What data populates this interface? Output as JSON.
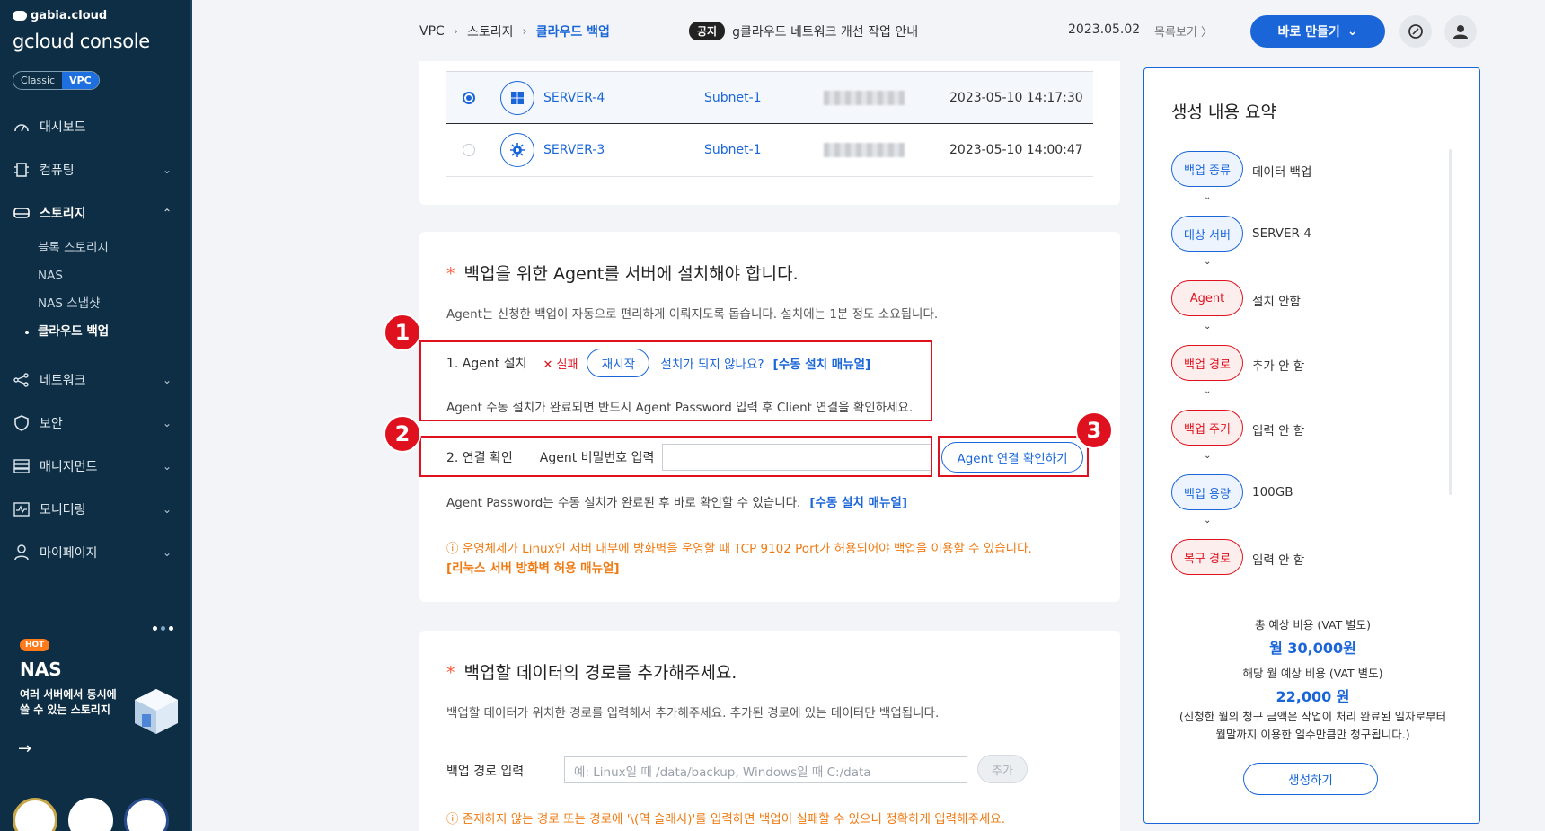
{
  "sidebar": {
    "brand_top": "gabia.cloud",
    "brand_main": "gcloud console",
    "mode_classic": "Classic",
    "mode_vpc": "VPC",
    "items": [
      {
        "label": "대시보드"
      },
      {
        "label": "컴퓨팅"
      },
      {
        "label": "스토리지"
      },
      {
        "label": "네트워크"
      },
      {
        "label": "보안"
      },
      {
        "label": "매니지먼트"
      },
      {
        "label": "모니터링"
      },
      {
        "label": "마이페이지"
      }
    ],
    "storage_sub": [
      {
        "label": "블록 스토리지"
      },
      {
        "label": "NAS"
      },
      {
        "label": "NAS 스냅샷"
      },
      {
        "label": "클라우드 백업"
      }
    ],
    "promo": {
      "badge": "HOT",
      "title": "NAS",
      "desc": "여러 서버에서 동시에 쓸 수 있는 스토리지",
      "arrow": "→"
    }
  },
  "topbar": {
    "crumbs": [
      "VPC",
      "스토리지",
      "클라우드 백업"
    ],
    "crumb_sep": "›",
    "notice_badge": "공지",
    "notice_text": "g클라우드 네트워크 개선 작업 안내",
    "notice_date": "2023.05.02",
    "notice_more": "목록보기 〉",
    "create_label": "바로 만들기"
  },
  "servers": [
    {
      "name": "SERVER-4",
      "subnet": "Subnet-1",
      "created": "2023-05-10 14:17:30",
      "selected": true,
      "os": "windows"
    },
    {
      "name": "SERVER-3",
      "subnet": "Subnet-1",
      "created": "2023-05-10 14:00:47",
      "selected": false,
      "os": "linux"
    }
  ],
  "agent_section": {
    "required_mark": "*",
    "title": "백업을 위한 Agent를 서버에 설치해야 합니다.",
    "desc": "Agent는 신청한 백업이 자동으로 편리하게 이뤄지도록 돕습니다. 설치에는 1분 정도 소요됩니다.",
    "step1_label": "1. Agent 설치",
    "fail_label": "✕ 실패",
    "retry_label": "재시작",
    "help_q": "설치가 되지 않나요?",
    "manual_link": "[수동 설치 매뉴얼]",
    "step1_note": "Agent 수동 설치가 완료되면 반드시 Agent Password 입력 후 Client 연결을 확인하세요.",
    "step2_label": "2. 연결 확인",
    "pw_label": "Agent 비밀번호 입력",
    "pw_value": "",
    "confirm_label": "Agent 연결 확인하기",
    "pw_note": "Agent Password는 수동 설치가 완료된 후 바로 확인할 수 있습니다.",
    "warning": "ⓘ 운영체제가 Linux인 서버 내부에 방화벽을 운영할 때 TCP 9102 Port가 허용되어야 백업을 이용할 수 있습니다.",
    "warning_link": "[리눅스 서버 방화벽 허용 매뉴얼]",
    "annotations": [
      "1",
      "2",
      "3"
    ]
  },
  "path_section": {
    "required_mark": "*",
    "title": "백업할 데이터의 경로를 추가해주세요.",
    "desc": "백업할 데이터가 위치한 경로를 입력해서 추가해주세요. 추가된 경로에 있는 데이터만 백업됩니다.",
    "input_label": "백업 경로 입력",
    "placeholder": "예: Linux일 때 /data/backup, Windows일 때 C:/data",
    "add_label": "추가",
    "warning": "ⓘ 존재하지 않는 경로 또는 경로에 '\\(역 슬래시)'를 입력하면 백업이 실패할 수 있으니 정확하게 입력해주세요."
  },
  "summary": {
    "title": "생성 내용 요약",
    "items": [
      {
        "label": "백업 종류",
        "value": "데이터 백업",
        "status": "ok"
      },
      {
        "label": "대상 서버",
        "value": "SERVER-4",
        "status": "ok"
      },
      {
        "label": "Agent",
        "value": "설치 안함",
        "status": "warn"
      },
      {
        "label": "백업 경로",
        "value": "추가 안 함",
        "status": "warn"
      },
      {
        "label": "백업 주기",
        "value": "입력 안 함",
        "status": "warn"
      },
      {
        "label": "백업 용량",
        "value": "100GB",
        "status": "ok"
      },
      {
        "label": "복구 경로",
        "value": "입력 안 함",
        "status": "warn"
      }
    ],
    "arrow": "⌄",
    "total_label": "총 예상 비용 (VAT 별도)",
    "total_value": "월 30,000원",
    "month_label": "해당 월 예상 비용 (VAT 별도)",
    "month_value": "22,000 원",
    "note_line1": "(신청한 월의 청구 금액은 작업이 처리 완료된 일자로부터",
    "note_line2": "월말까지 이용한 일수만큼만 청구됩니다.)",
    "create_label": "생성하기"
  },
  "colors": {
    "primary": "#1a66d9",
    "sidebar": "#0d2e44",
    "danger": "#e0111e",
    "warning": "#f07a12"
  }
}
